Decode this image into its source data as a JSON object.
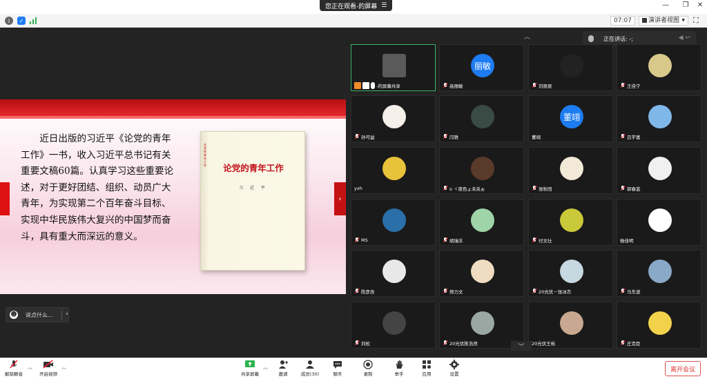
{
  "titlebar": {
    "share_status": "您正在观看-的屏幕",
    "menu_icon": "menu-icon",
    "minimize": "—",
    "restore": "❐",
    "close": "✕"
  },
  "toolbar2": {
    "timer": "07:07",
    "view_mode": "演讲者视图",
    "icons": [
      "info-icon",
      "shield-icon",
      "signal-icon"
    ]
  },
  "slide": {
    "paragraph": "近日出版的习近平《论党的青年工作》一书，收入习近平总书记有关重要文稿60篇。认真学习这些重要论述，对于更好团结、组织、动员广大青年，为实现第二个百年奋斗目标、实现中华民族伟大复兴的中国梦而奋斗，具有重大而深远的意义。",
    "book_title": "论党的青年工作",
    "book_author": "习 近 平",
    "book_spine": "论党的青年工作"
  },
  "chat": {
    "placeholder": "说点什么..."
  },
  "speaking": {
    "label": "正在讲话: -;"
  },
  "tiles": [
    {
      "name": "-的屏幕共享",
      "avatar_text": "",
      "color": "#5a5a5a",
      "kind": "share"
    },
    {
      "name": "高丽敏",
      "avatar_text": "丽敏",
      "color": "#1e7cf2",
      "kind": "muted"
    },
    {
      "name": "刘原辰",
      "avatar_text": "",
      "color": "#222",
      "kind": "muted"
    },
    {
      "name": "王佳宁",
      "avatar_text": "",
      "color": "#d8c98a",
      "kind": "muted"
    },
    {
      "name": "孙可益",
      "avatar_text": "",
      "color": "#f4efe9",
      "kind": "muted"
    },
    {
      "name": "闫轶",
      "avatar_text": "",
      "color": "#3a4a45",
      "kind": "muted"
    },
    {
      "name": "董翊",
      "avatar_text": "董翊",
      "color": "#1e7cf2",
      "kind": "plain"
    },
    {
      "name": "吕宇富",
      "avatar_text": "",
      "color": "#7fb7e8",
      "kind": "muted"
    },
    {
      "name": "yxh",
      "avatar_text": "",
      "color": "#e8c23a",
      "kind": "plain"
    },
    {
      "name": "ο ヾ夜色ょ未央ぉ",
      "avatar_text": "",
      "color": "#5a3a2a",
      "kind": "muted"
    },
    {
      "name": "张秋阳",
      "avatar_text": "",
      "color": "#f2e9d8",
      "kind": "muted"
    },
    {
      "name": "郭春蓝",
      "avatar_text": "",
      "color": "#f0f0f0",
      "kind": "muted"
    },
    {
      "name": "MS",
      "avatar_text": "",
      "color": "#2b6fa8",
      "kind": "muted"
    },
    {
      "name": "胡瑞丰",
      "avatar_text": "",
      "color": "#9ed4a8",
      "kind": "muted"
    },
    {
      "name": "付文壮",
      "avatar_text": "",
      "color": "#c9c93a",
      "kind": "muted"
    },
    {
      "name": "杨佳明",
      "avatar_text": "",
      "color": "#ffffff",
      "kind": "plain"
    },
    {
      "name": "陈彦孜",
      "avatar_text": "",
      "color": "#e8e8e8",
      "kind": "muted"
    },
    {
      "name": "郑力文",
      "avatar_text": "",
      "color": "#f0dcc0",
      "kind": "muted"
    },
    {
      "name": "20光伏－张冰杰",
      "avatar_text": "",
      "color": "#c8d8e0",
      "kind": "muted"
    },
    {
      "name": "马东波",
      "avatar_text": "",
      "color": "#8aa8c8",
      "kind": "muted"
    },
    {
      "name": "刘松",
      "avatar_text": "",
      "color": "#444444",
      "kind": "muted"
    },
    {
      "name": "20光伏陈浩然",
      "avatar_text": "",
      "color": "#9aa8a4",
      "kind": "muted"
    },
    {
      "name": "20光伏王栎",
      "avatar_text": "",
      "color": "#c8a890",
      "kind": "plain"
    },
    {
      "name": "庄克臣",
      "avatar_text": "",
      "color": "#f2d24a",
      "kind": "muted"
    }
  ],
  "bottombar": {
    "unmute": "解除静音",
    "start_video": "开启视频",
    "share_screen": "共享屏幕",
    "invite": "邀请",
    "members": "成员(30)",
    "chat": "聊天",
    "record": "录制",
    "raise_hand": "举手",
    "apps": "应用",
    "settings": "设置",
    "leave": "离开会议"
  }
}
